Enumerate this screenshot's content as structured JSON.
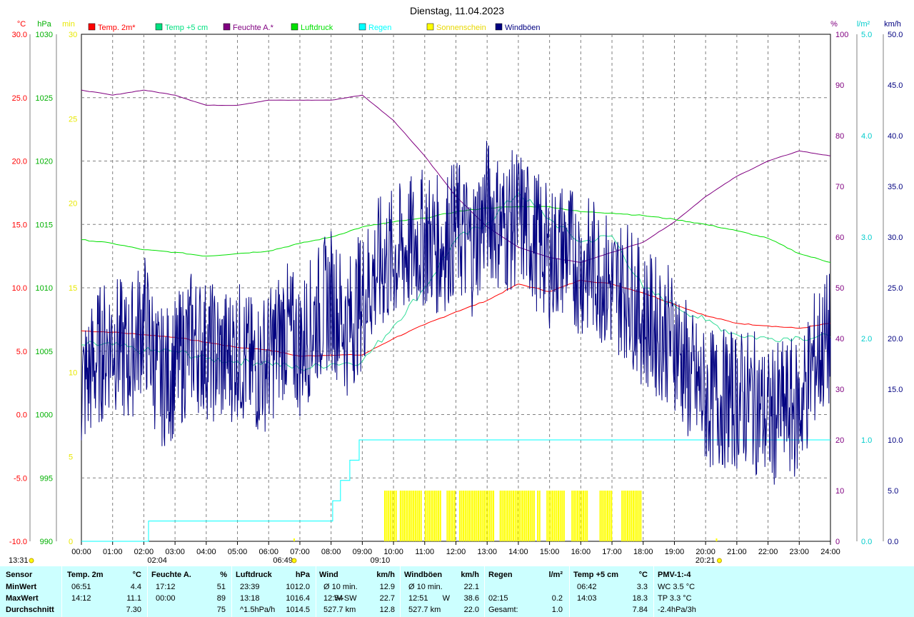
{
  "chart_data": {
    "type": "line",
    "title": "Dienstag, 11.04.2023",
    "legend": [
      {
        "label": "Temp. 2m*",
        "color": "#ff0000"
      },
      {
        "label": "Temp +5 cm",
        "color": "#00e080"
      },
      {
        "label": "Feuchte A.*",
        "color": "#800080"
      },
      {
        "label": "Luftdruck",
        "color": "#00e000"
      },
      {
        "label": "Regen",
        "color": "#00ffff"
      },
      {
        "label": "Sonnenschein",
        "color": "#ffff00"
      },
      {
        "label": "Windböen",
        "color": "#000080"
      }
    ],
    "x_ticks": [
      "00:00",
      "01:00",
      "02:00",
      "03:00",
      "04:00",
      "05:00",
      "06:00",
      "07:00",
      "08:00",
      "09:00",
      "10:00",
      "11:00",
      "12:00",
      "13:00",
      "14:00",
      "15:00",
      "16:00",
      "17:00",
      "18:00",
      "19:00",
      "20:00",
      "21:00",
      "22:00",
      "23:00",
      "24:00"
    ],
    "axes": {
      "temp": {
        "unit": "°C",
        "range": [
          -10,
          30
        ],
        "ticks": [
          "30.0",
          "25.0",
          "20.0",
          "15.0",
          "10.0",
          "5.0",
          "0.0",
          "-5.0",
          "-10.0"
        ],
        "color": "#ff0000"
      },
      "pressure": {
        "unit": "hPa",
        "range": [
          990,
          1030
        ],
        "ticks": [
          "1030",
          "1025",
          "1020",
          "1015",
          "1010",
          "1005",
          "1000",
          "995",
          "990"
        ],
        "color": "#00b000"
      },
      "sun_min": {
        "unit": "min",
        "range": [
          0,
          30
        ],
        "ticks": [
          "30",
          "25",
          "20",
          "15",
          "10",
          "5",
          "0"
        ],
        "color": "#e8e800"
      },
      "humidity": {
        "unit": "%",
        "range": [
          0,
          100
        ],
        "ticks": [
          "100",
          "90",
          "80",
          "70",
          "60",
          "50",
          "40",
          "30",
          "20",
          "10",
          "0"
        ],
        "color": "#800080"
      },
      "rain": {
        "unit": "l/m²",
        "range": [
          0,
          5
        ],
        "ticks": [
          "5.0",
          "4.0",
          "3.0",
          "2.0",
          "1.0",
          "0.0"
        ],
        "color": "#00cccc"
      },
      "wind": {
        "unit": "km/h",
        "range": [
          0,
          50
        ],
        "ticks": [
          "50.0",
          "45.0",
          "40.0",
          "35.0",
          "30.0",
          "25.0",
          "20.0",
          "15.0",
          "10.0",
          "5.0",
          "0.0"
        ],
        "color": "#000080"
      }
    },
    "series": [
      {
        "name": "Temp. 2m*",
        "axis": "temp",
        "x": [
          0,
          1,
          2,
          3,
          4,
          5,
          6,
          7,
          8,
          9,
          10,
          11,
          12,
          13,
          14,
          15,
          16,
          17,
          18,
          19,
          20,
          21,
          22,
          23,
          24
        ],
        "y": [
          6.6,
          6.5,
          6.3,
          6.1,
          5.7,
          5.3,
          5.1,
          4.6,
          4.7,
          4.7,
          6.0,
          7.1,
          8.1,
          9.0,
          10.3,
          9.7,
          10.6,
          10.3,
          9.6,
          8.7,
          7.8,
          7.2,
          7.0,
          6.8,
          7.2
        ]
      },
      {
        "name": "Temp +5 cm",
        "axis": "temp",
        "x": [
          0,
          1,
          2,
          3,
          4,
          5,
          6,
          7,
          8,
          9,
          10,
          11,
          12,
          13,
          14,
          15,
          16,
          17,
          18,
          19,
          20,
          21,
          22,
          23,
          24
        ],
        "y": [
          5.5,
          5.5,
          5.0,
          5.0,
          4.4,
          4.2,
          4.1,
          3.6,
          4.0,
          4.2,
          7.0,
          10.0,
          13.8,
          15.1,
          17.5,
          15.4,
          13.6,
          14.1,
          10.0,
          8.6,
          7.4,
          6.3,
          6.0,
          6.1,
          6.1
        ]
      },
      {
        "name": "Feuchte A.*",
        "axis": "humidity",
        "x": [
          0,
          1,
          2,
          3,
          4,
          5,
          6,
          7,
          8,
          9,
          10,
          11,
          12,
          13,
          14,
          15,
          16,
          17,
          18,
          19,
          20,
          21,
          22,
          23,
          24
        ],
        "y": [
          89,
          88,
          89,
          88,
          86,
          86,
          87,
          87,
          87,
          88,
          83,
          76,
          68,
          62,
          58,
          56,
          55,
          57,
          59,
          63,
          68,
          72,
          75,
          77,
          76
        ]
      },
      {
        "name": "Luftdruck",
        "axis": "pressure",
        "x": [
          0,
          1,
          2,
          3,
          4,
          5,
          6,
          7,
          8,
          9,
          10,
          11,
          12,
          13,
          14,
          15,
          16,
          17,
          18,
          19,
          20,
          21,
          22,
          23,
          24
        ],
        "y": [
          1013.8,
          1013.5,
          1013.0,
          1012.8,
          1012.5,
          1012.7,
          1012.9,
          1013.5,
          1014.0,
          1014.8,
          1015.2,
          1015.5,
          1016.0,
          1016.3,
          1016.4,
          1016.4,
          1016.0,
          1015.9,
          1015.7,
          1015.4,
          1015.0,
          1014.5,
          1013.9,
          1012.7,
          1012.0
        ]
      },
      {
        "name": "Regen",
        "axis": "rain",
        "x": [
          0,
          2.1,
          2.15,
          8.0,
          8.05,
          8.3,
          8.6,
          8.9,
          9.0,
          24
        ],
        "y": [
          0,
          0,
          0.2,
          0.2,
          0.4,
          0.6,
          0.8,
          1.0,
          1.0,
          1.0
        ]
      },
      {
        "name": "Windböen",
        "axis": "wind",
        "x": [
          0,
          0.5,
          1,
          1.5,
          2,
          2.5,
          3,
          3.5,
          4,
          4.5,
          5,
          5.5,
          6,
          6.5,
          7,
          7.5,
          8,
          8.5,
          9,
          9.5,
          10,
          10.5,
          11,
          11.5,
          12,
          12.5,
          13,
          13.5,
          14,
          14.5,
          15,
          15.5,
          16,
          16.5,
          17,
          17.5,
          18,
          18.5,
          19,
          19.5,
          20,
          20.5,
          21,
          21.5,
          22,
          22.5,
          23,
          23.5,
          24
        ],
        "y": [
          15,
          18,
          20,
          18,
          22,
          16,
          17,
          20,
          19,
          18,
          19,
          17,
          18,
          21,
          19,
          22,
          24,
          21,
          24,
          27,
          28,
          29,
          30,
          29,
          31,
          29,
          33,
          31,
          32,
          30,
          28,
          29,
          27,
          27,
          25,
          25,
          22,
          21,
          20,
          16,
          14,
          14,
          14,
          14,
          12,
          13,
          13,
          18,
          20
        ]
      },
      {
        "name": "Sonnenschein",
        "axis": "sun_min",
        "segments": [
          [
            9.7,
            10.1
          ],
          [
            10.2,
            10.9
          ],
          [
            11.0,
            11.5
          ],
          [
            11.7,
            12.0
          ],
          [
            12.1,
            13.2
          ],
          [
            13.4,
            14.5
          ],
          [
            14.6,
            14.7
          ],
          [
            14.9,
            15.5
          ],
          [
            15.7,
            16.2
          ],
          [
            16.6,
            17.0
          ],
          [
            17.3,
            17.9
          ]
        ],
        "value": 3
      }
    ],
    "markers": {
      "sunrise": "06:49",
      "sunset": "20:21",
      "rain_start": "02:04",
      "rain_end": "09:10",
      "time_now": "13:31"
    }
  },
  "stats": {
    "headers": [
      {
        "name": "Sensor",
        "unit": ""
      },
      {
        "name": "Temp. 2m",
        "unit": "°C"
      },
      {
        "name": "Feuchte A.",
        "unit": "%"
      },
      {
        "name": "Luftdruck",
        "unit": "hPa"
      },
      {
        "name": "Wind",
        "unit": "km/h"
      },
      {
        "name": "Windböen",
        "unit": "km/h"
      },
      {
        "name": "Regen",
        "unit": "l/m²"
      },
      {
        "name": "Temp +5 cm",
        "unit": "°C"
      },
      {
        "name": "PMV-1:-4",
        "unit": ""
      }
    ],
    "rows": [
      {
        "label": "MinWert",
        "temp_time": "06:51",
        "temp_val": "4.4",
        "hum_time": "17:12",
        "hum_val": "51",
        "press_time": "23:39",
        "press_val": "1012.0",
        "wind_time": "Ø 10 min.",
        "wind_dir": "",
        "wind_val": "12.9",
        "gust_time": "Ø 10 min.",
        "gust_dir": "",
        "gust_val": "22.1",
        "rain_time": "",
        "rain_val": "",
        "t5_time": "06:42",
        "t5_val": "3.3",
        "pmv": "WC 3.5 °C"
      },
      {
        "label": "MaxWert",
        "temp_time": "14:12",
        "temp_val": "11.1",
        "hum_time": "00:00",
        "hum_val": "89",
        "press_time": "13:18",
        "press_val": "1016.4",
        "wind_time": "12:54",
        "wind_dir": "W-SW",
        "wind_val": "22.7",
        "gust_time": "12:51",
        "gust_dir": "W",
        "gust_val": "38.6",
        "rain_time": "02:15",
        "rain_val": "0.2",
        "t5_time": "14:03",
        "t5_val": "18.3",
        "pmv": "TP 3.3 °C"
      },
      {
        "label": "Durchschnitt",
        "temp_time": "",
        "temp_val": "7.30",
        "hum_time": "",
        "hum_val": "75",
        "press_time": "^1.5hPa/h",
        "press_val": "1014.5",
        "wind_time": "527.7 km",
        "wind_dir": "",
        "wind_val": "12.8",
        "gust_time": "527.7 km",
        "gust_dir": "",
        "gust_val": "22.0",
        "rain_time": "Gesamt:",
        "rain_val": "1.0",
        "t5_time": "",
        "t5_val": "7.84",
        "pmv": "-2.4hPa/3h"
      }
    ]
  }
}
